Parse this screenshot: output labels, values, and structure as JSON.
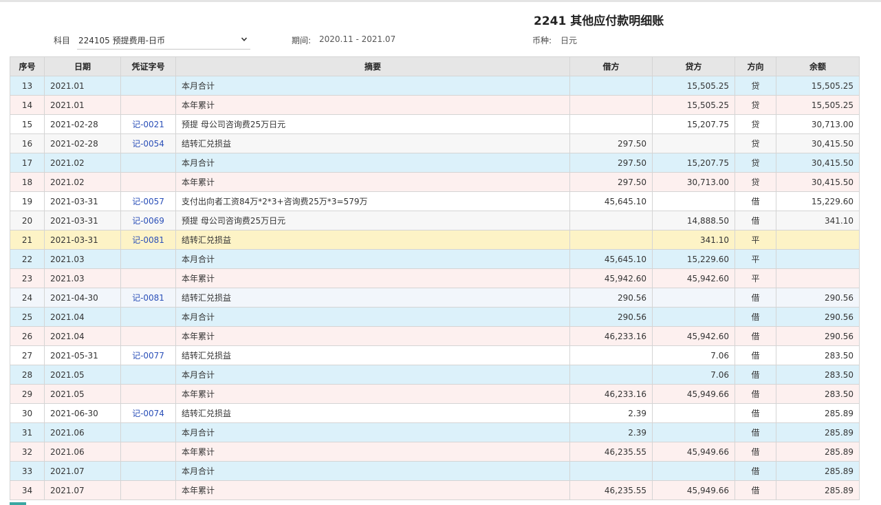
{
  "title": "2241 其他应付款明细账",
  "filters": {
    "subject_label": "科目",
    "subject_value": "224105 预提费用-日币",
    "period_label": "期间:",
    "period_value": "2020.11 - 2021.07",
    "currency_label": "币种:",
    "currency_value": "日元"
  },
  "table": {
    "headers": [
      "序号",
      "日期",
      "凭证字号",
      "摘要",
      "借方",
      "贷方",
      "方向",
      "余额"
    ],
    "rows": [
      {
        "type": "month",
        "seq": "13",
        "date": "2021.01",
        "voucher": "",
        "summary": "本月合计",
        "debit": "",
        "credit": "15,505.25",
        "dir": "贷",
        "balance": "15,505.25"
      },
      {
        "type": "year",
        "seq": "14",
        "date": "2021.01",
        "voucher": "",
        "summary": "本年累计",
        "debit": "",
        "credit": "15,505.25",
        "dir": "贷",
        "balance": "15,505.25"
      },
      {
        "type": "normal",
        "seq": "15",
        "date": "2021-02-28",
        "voucher": "记-0021",
        "summary": "预提 母公司咨询费25万日元",
        "debit": "",
        "credit": "15,207.75",
        "dir": "贷",
        "balance": "30,713.00"
      },
      {
        "type": "alt",
        "seq": "16",
        "date": "2021-02-28",
        "voucher": "记-0054",
        "summary": "结转汇兑损益",
        "debit": "297.50",
        "credit": "",
        "dir": "贷",
        "balance": "30,415.50"
      },
      {
        "type": "month",
        "seq": "17",
        "date": "2021.02",
        "voucher": "",
        "summary": "本月合计",
        "debit": "297.50",
        "credit": "15,207.75",
        "dir": "贷",
        "balance": "30,415.50"
      },
      {
        "type": "year",
        "seq": "18",
        "date": "2021.02",
        "voucher": "",
        "summary": "本年累计",
        "debit": "297.50",
        "credit": "30,713.00",
        "dir": "贷",
        "balance": "30,415.50"
      },
      {
        "type": "normal",
        "seq": "19",
        "date": "2021-03-31",
        "voucher": "记-0057",
        "summary": "支付出向者工资84万*2*3+咨询费25万*3=579万",
        "debit": "45,645.10",
        "credit": "",
        "dir": "借",
        "balance": "15,229.60"
      },
      {
        "type": "alt",
        "seq": "20",
        "date": "2021-03-31",
        "voucher": "记-0069",
        "summary": "预提 母公司咨询费25万日元",
        "debit": "",
        "credit": "14,888.50",
        "dir": "借",
        "balance": "341.10"
      },
      {
        "type": "highlight",
        "seq": "21",
        "date": "2021-03-31",
        "voucher": "记-0081",
        "summary": "结转汇兑损益",
        "debit": "",
        "credit": "341.10",
        "dir": "平",
        "balance": ""
      },
      {
        "type": "month",
        "seq": "22",
        "date": "2021.03",
        "voucher": "",
        "summary": "本月合计",
        "debit": "45,645.10",
        "credit": "15,229.60",
        "dir": "平",
        "balance": ""
      },
      {
        "type": "year",
        "seq": "23",
        "date": "2021.03",
        "voucher": "",
        "summary": "本年累计",
        "debit": "45,942.60",
        "credit": "45,942.60",
        "dir": "平",
        "balance": ""
      },
      {
        "type": "light",
        "seq": "24",
        "date": "2021-04-30",
        "voucher": "记-0081",
        "summary": "结转汇兑损益",
        "debit": "290.56",
        "credit": "",
        "dir": "借",
        "balance": "290.56"
      },
      {
        "type": "month",
        "seq": "25",
        "date": "2021.04",
        "voucher": "",
        "summary": "本月合计",
        "debit": "290.56",
        "credit": "",
        "dir": "借",
        "balance": "290.56"
      },
      {
        "type": "year",
        "seq": "26",
        "date": "2021.04",
        "voucher": "",
        "summary": "本年累计",
        "debit": "46,233.16",
        "credit": "45,942.60",
        "dir": "借",
        "balance": "290.56"
      },
      {
        "type": "normal",
        "seq": "27",
        "date": "2021-05-31",
        "voucher": "记-0077",
        "summary": "结转汇兑损益",
        "debit": "",
        "credit": "7.06",
        "dir": "借",
        "balance": "283.50"
      },
      {
        "type": "month",
        "seq": "28",
        "date": "2021.05",
        "voucher": "",
        "summary": "本月合计",
        "debit": "",
        "credit": "7.06",
        "dir": "借",
        "balance": "283.50"
      },
      {
        "type": "year",
        "seq": "29",
        "date": "2021.05",
        "voucher": "",
        "summary": "本年累计",
        "debit": "46,233.16",
        "credit": "45,949.66",
        "dir": "借",
        "balance": "283.50"
      },
      {
        "type": "normal",
        "seq": "30",
        "date": "2021-06-30",
        "voucher": "记-0074",
        "summary": "结转汇兑损益",
        "debit": "2.39",
        "credit": "",
        "dir": "借",
        "balance": "285.89"
      },
      {
        "type": "month",
        "seq": "31",
        "date": "2021.06",
        "voucher": "",
        "summary": "本月合计",
        "debit": "2.39",
        "credit": "",
        "dir": "借",
        "balance": "285.89"
      },
      {
        "type": "year",
        "seq": "32",
        "date": "2021.06",
        "voucher": "",
        "summary": "本年累计",
        "debit": "46,235.55",
        "credit": "45,949.66",
        "dir": "借",
        "balance": "285.89"
      },
      {
        "type": "month",
        "seq": "33",
        "date": "2021.07",
        "voucher": "",
        "summary": "本月合计",
        "debit": "",
        "credit": "",
        "dir": "借",
        "balance": "285.89"
      },
      {
        "type": "year",
        "seq": "34",
        "date": "2021.07",
        "voucher": "",
        "summary": "本年累计",
        "debit": "46,235.55",
        "credit": "45,949.66",
        "dir": "借",
        "balance": "285.89"
      }
    ]
  },
  "icons": {
    "subject_dropdown": "chevron-down-icon"
  },
  "colors": {
    "voucher_link": "#2a4fb8",
    "month_total_row": "#dcf1fa",
    "year_total_row": "#fdf0ef",
    "highlight_row": "#fdf3c6",
    "header_bg": "#e6e6e6"
  }
}
